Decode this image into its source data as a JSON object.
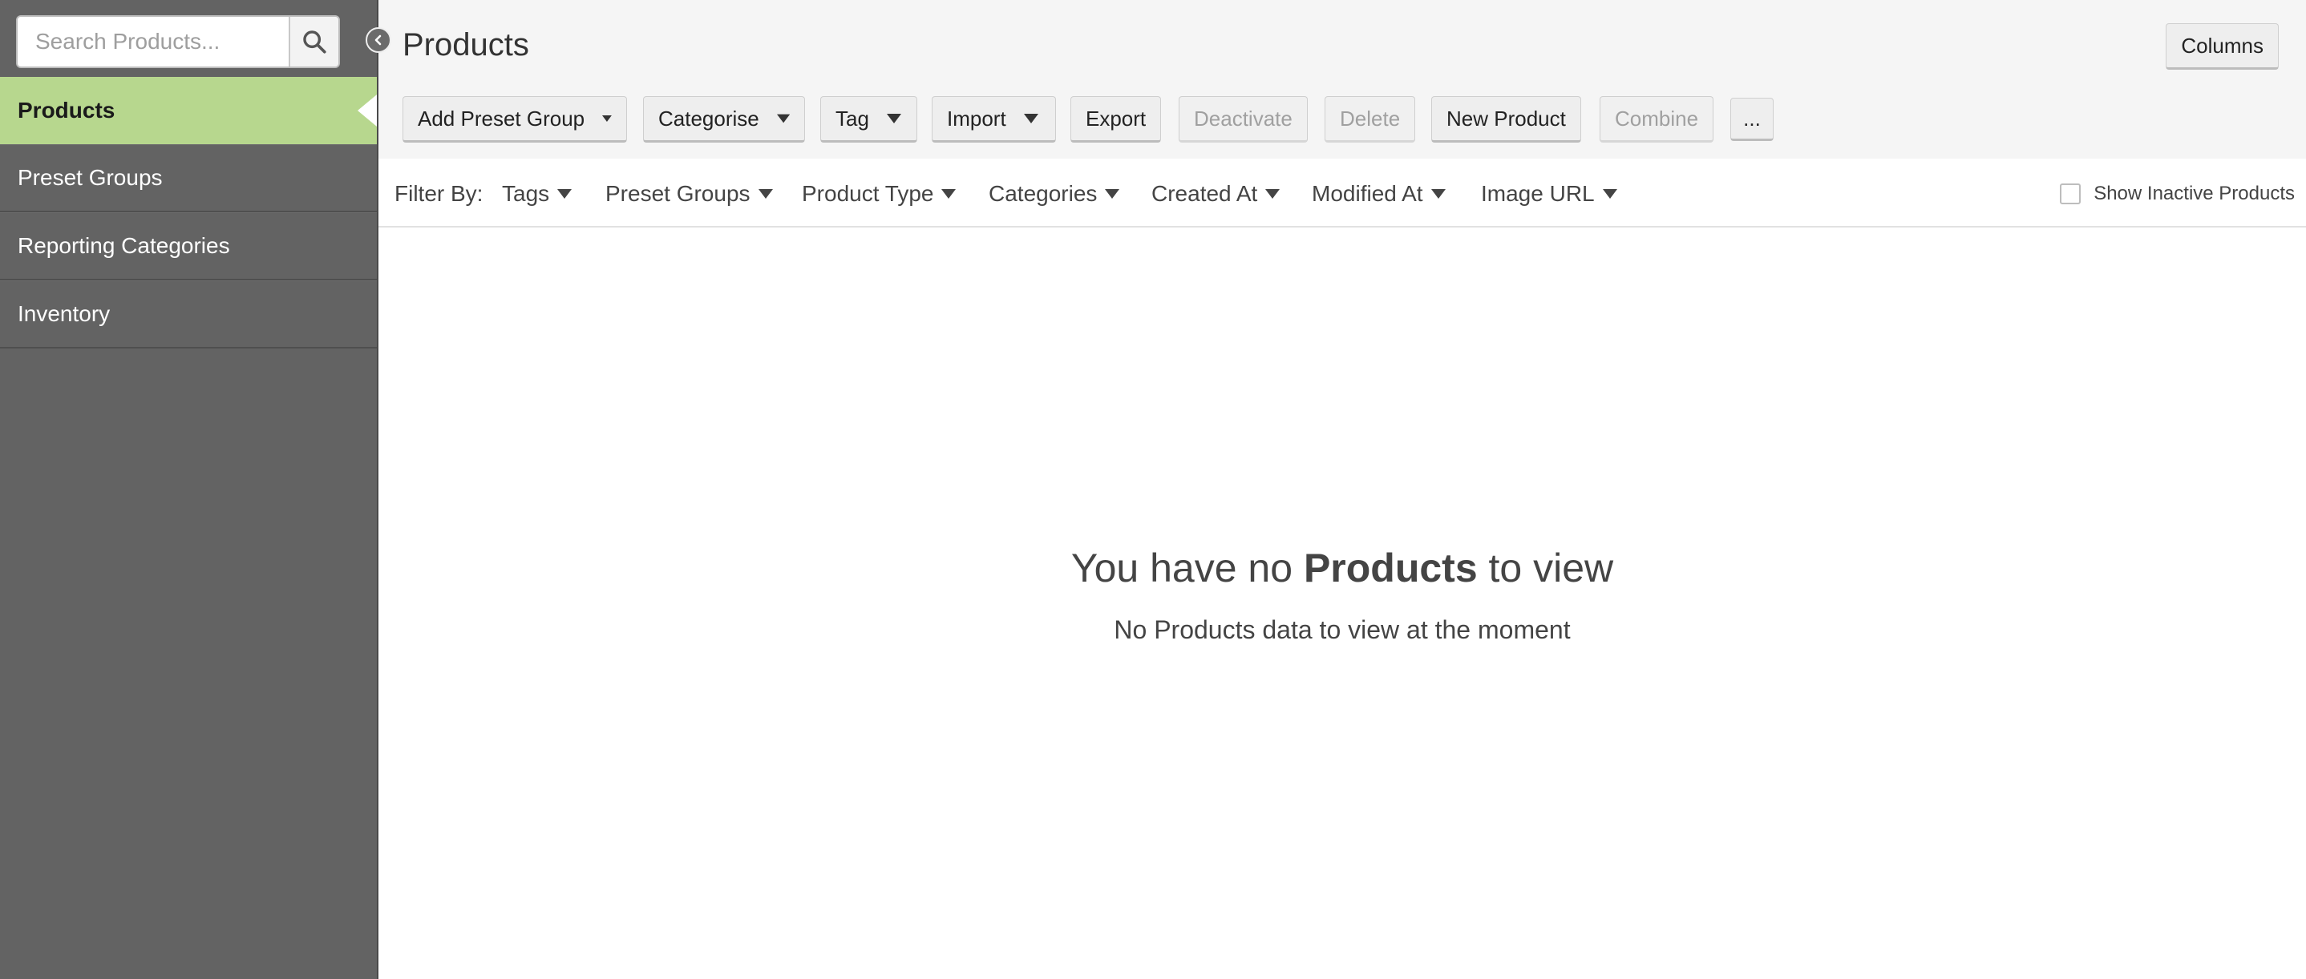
{
  "sidebar": {
    "search_placeholder": "Search Products...",
    "items": [
      {
        "label": "Products",
        "active": true
      },
      {
        "label": "Preset Groups"
      },
      {
        "label": "Reporting Categories"
      },
      {
        "label": "Inventory"
      }
    ]
  },
  "header": {
    "title": "Products",
    "columns_label": "Columns"
  },
  "toolbar": {
    "add_preset_group": "Add Preset Group",
    "categorise": "Categorise",
    "tag": "Tag",
    "import": "Import",
    "export": "Export",
    "deactivate": "Deactivate",
    "delete": "Delete",
    "new_product": "New Product",
    "combine": "Combine",
    "more": "..."
  },
  "filters": {
    "label": "Filter By:",
    "items": [
      "Tags",
      "Preset Groups",
      "Product Type",
      "Categories",
      "Created At",
      "Modified At",
      "Image URL"
    ],
    "show_inactive": "Show Inactive Products"
  },
  "empty_state": {
    "prefix": "You have no ",
    "bold": "Products",
    "suffix": " to view",
    "subtitle": "No Products data to view at the moment"
  },
  "colors": {
    "sidebar_bg": "#636363",
    "active_item": "#b7d78e",
    "toolbar_bg": "#f5f5f5"
  }
}
